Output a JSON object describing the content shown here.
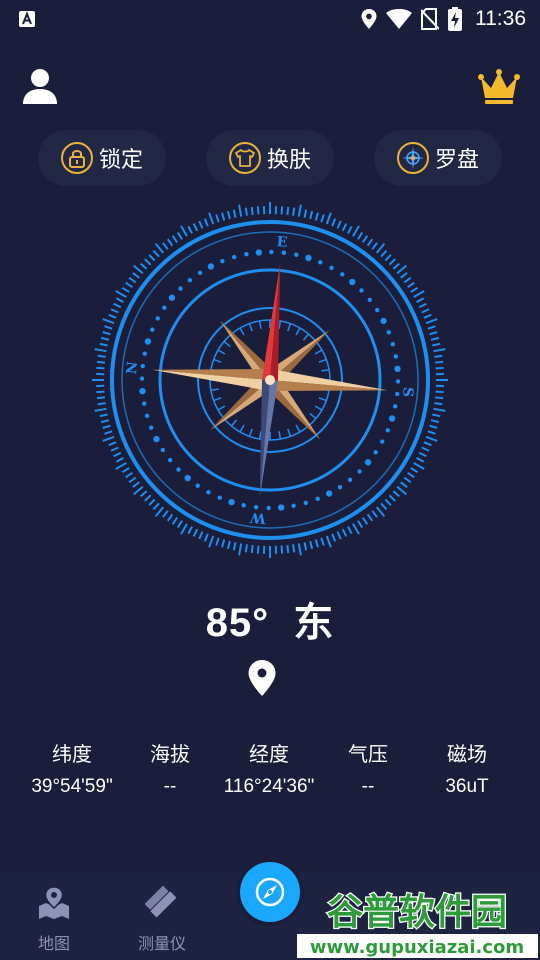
{
  "status_bar": {
    "time": "11:36",
    "icons": [
      "app-a-icon",
      "location-icon",
      "wifi-icon",
      "no-sim-icon",
      "battery-charging-icon"
    ]
  },
  "top_bar": {
    "left_icon": "user-icon",
    "right_icon": "crown-icon"
  },
  "actions": [
    {
      "label": "锁定",
      "icon": "lock-icon"
    },
    {
      "label": "换肤",
      "icon": "shirt-icon"
    },
    {
      "label": "罗盘",
      "icon": "compass-rose-icon"
    }
  ],
  "compass": {
    "dial_letters": [
      "E",
      "S",
      "W",
      "N"
    ],
    "heading_degrees": 85,
    "accent_color": "#1e8ff0",
    "needle_color": "#e23a3a"
  },
  "heading": {
    "degrees": "85°",
    "direction": "东"
  },
  "stats": [
    {
      "label": "纬度",
      "value": "39°54'59\""
    },
    {
      "label": "海拔",
      "value": "--"
    },
    {
      "label": "经度",
      "value": "116°24'36\""
    },
    {
      "label": "气压",
      "value": "--"
    },
    {
      "label": "磁场",
      "value": "36uT"
    }
  ],
  "bottom_nav": {
    "items": [
      {
        "label": "地图",
        "icon": "map-pin-icon"
      },
      {
        "label": "测量仪",
        "icon": "ruler-pencil-icon"
      }
    ],
    "center_icon": "compass-needle-icon"
  },
  "watermark": {
    "title": "谷普软件园",
    "url": "www.gupuxiazai.com"
  },
  "colors": {
    "background": "#1b1e3a",
    "pill_background": "#232746",
    "gold": "#e8b53a",
    "fab": "#1aa7ff"
  }
}
